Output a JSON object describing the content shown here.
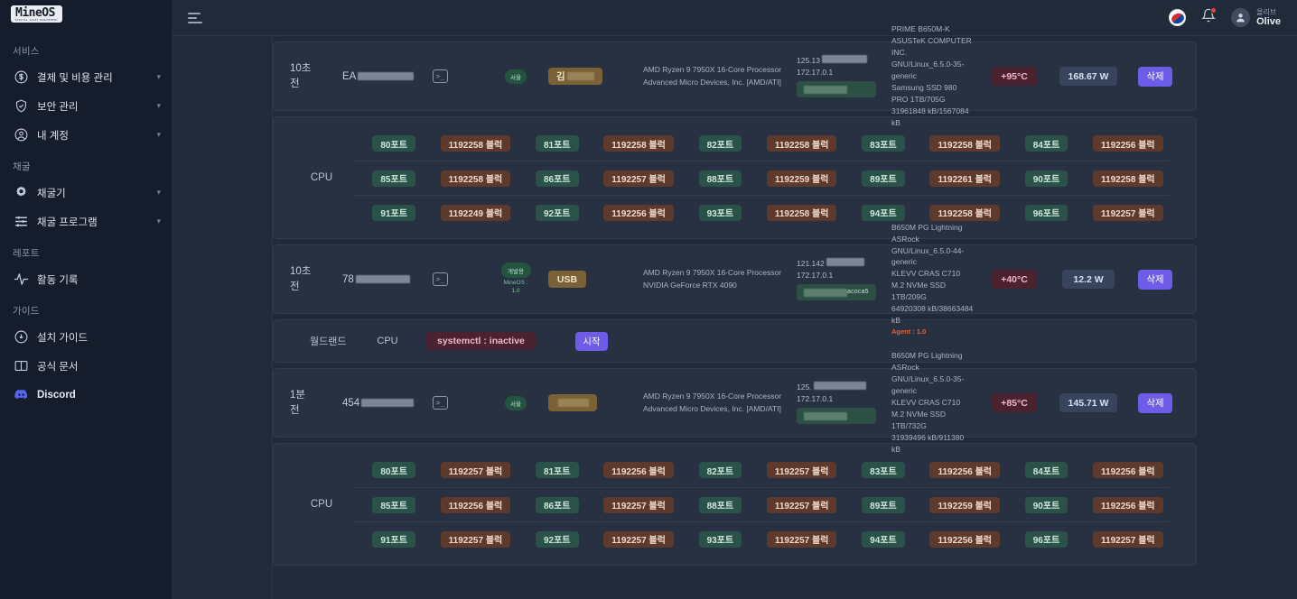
{
  "brand": {
    "logo": "MineOS",
    "logo_sub": "DIGITAL ASSET MANAGEMENT"
  },
  "sidebar": {
    "sections": [
      {
        "title": "서비스",
        "items": [
          {
            "label": "결제 및 비용 관리",
            "icon": "dollar-circle-icon",
            "caret": "⌄"
          },
          {
            "label": "보안 관리",
            "icon": "shield-check-icon",
            "caret": "⌄"
          },
          {
            "label": "내 계정",
            "icon": "user-circle-icon",
            "caret": "⌄"
          }
        ]
      },
      {
        "title": "채굴",
        "items": [
          {
            "label": "채굴기",
            "icon": "gear-icon",
            "caret": "⌄"
          },
          {
            "label": "채굴 프로그램",
            "icon": "sliders-icon",
            "caret": "⌄"
          }
        ]
      },
      {
        "title": "레포트",
        "items": [
          {
            "label": "활동 기록",
            "icon": "activity-pulse-icon",
            "caret": ""
          }
        ]
      },
      {
        "title": "가이드",
        "items": [
          {
            "label": "설치 가이드",
            "icon": "cloud-download-icon",
            "caret": ""
          },
          {
            "label": "공식 문서",
            "icon": "book-icon",
            "caret": ""
          },
          {
            "label": "Discord",
            "icon": "discord-icon",
            "caret": ""
          }
        ]
      }
    ]
  },
  "topbar": {
    "menu_icon": "hamburger-icon",
    "flag_icon": "korea-flag-icon",
    "bell_icon": "bell-icon",
    "notification_dot": true,
    "avatar_icon": "user-avatar-icon",
    "user_name_kr": "올리브",
    "user_name_en": "Olive"
  },
  "machines": [
    {
      "time": "10초 전",
      "name_prefix": "EA",
      "name_redact_width": 62,
      "terminal_icon": "terminal-icon",
      "region": "서울",
      "region_sub": "",
      "tag_prefix": "김",
      "tag_redact_width": 30,
      "tag_text": "",
      "cpu": "AMD Ryzen 9 7950X 16-Core Processor\nAdvanced Micro Devices, Inc. [AMD/ATI]",
      "ip1": "125.13",
      "ip1_redact_width": 50,
      "ip2": "172.17.0.1",
      "ip_badge": "",
      "ip_badge_redact": true,
      "spec": "PRIME B650M-K ASUSTeK COMPUTER INC.\nGNU/Linux_6.5.0-35-generic\nSamsung SSD 980 PRO 1TB/705G\n31961848 kB/1567084 kB",
      "agent": "",
      "temp": "+95°C",
      "watt": "168.67 W",
      "delete_label": "삭제"
    },
    {
      "time": "10초 전",
      "name_prefix": "78",
      "name_redact_width": 60,
      "terminal_icon": "terminal-icon",
      "region": "개발용",
      "region_sub": "MineOS :\n1.0",
      "tag_prefix": "",
      "tag_redact_width": 0,
      "tag_text": "USB",
      "cpu": "AMD Ryzen 9 7950X 16-Core Processor\nNVIDIA GeForce RTX 4090",
      "ip1": "121.142",
      "ip1_redact_width": 42,
      "ip2": "172.17.0.1",
      "ip_badge": "acoca5",
      "ip_badge_redact": true,
      "spec": "B650M PG Lightning ASRock\nGNU/Linux_6.5.0-44-generic\nKLEVV CRAS C710 M.2 NVMe SSD 1TB/209G\n64920308 kB/38663484 kB",
      "agent": "Agent : 1.0",
      "temp": "+40°C",
      "watt": "12.2 W",
      "delete_label": "삭제"
    },
    {
      "time": "1분 전",
      "name_prefix": "454",
      "name_redact_width": 58,
      "terminal_icon": "terminal-icon",
      "region": "서울",
      "region_sub": "",
      "tag_prefix": "",
      "tag_redact_width": 34,
      "tag_text": "",
      "cpu": "AMD Ryzen 9 7950X 16-Core Processor\nAdvanced Micro Devices, Inc. [AMD/ATI]",
      "ip1": "125.",
      "ip1_redact_width": 58,
      "ip2": "172.17.0.1",
      "ip_badge": "",
      "ip_badge_redact": true,
      "spec": "B650M PG Lightning ASRock\nGNU/Linux_6.5.0-35-generic\nKLEVV CRAS C710 M.2 NVMe SSD 1TB/732G\n31939496 kB/911380 kB",
      "agent": "",
      "temp": "+85°C",
      "watt": "145.71 W",
      "delete_label": "삭제"
    }
  ],
  "port_grids": [
    {
      "label": "CPU",
      "rows": [
        [
          "80포트",
          "1192258 블럭",
          "81포트",
          "1192258 블럭",
          "82포트",
          "1192258 블럭",
          "83포트",
          "1192258 블럭",
          "84포트",
          "1192256 블럭"
        ],
        [
          "85포트",
          "1192258 블럭",
          "86포트",
          "1192257 블럭",
          "88포트",
          "1192259 블럭",
          "89포트",
          "1192261 블럭",
          "90포트",
          "1192258 블럭"
        ],
        [
          "91포트",
          "1192249 블럭",
          "92포트",
          "1192256 블럭",
          "93포트",
          "1192258 블럭",
          "94포트",
          "1192258 블럭",
          "96포트",
          "1192257 블럭"
        ]
      ]
    },
    {
      "label": "CPU",
      "rows": [
        [
          "80포트",
          "1192257 블럭",
          "81포트",
          "1192256 블럭",
          "82포트",
          "1192257 블럭",
          "83포트",
          "1192256 블럭",
          "84포트",
          "1192256 블럭"
        ],
        [
          "85포트",
          "1192256 블럭",
          "86포트",
          "1192257 블럭",
          "88포트",
          "1192257 블럭",
          "89포트",
          "1192259 블럭",
          "90포트",
          "1192256 블럭"
        ],
        [
          "91포트",
          "1192257 블럭",
          "92포트",
          "1192257 블럭",
          "93포트",
          "1192257 블럭",
          "94포트",
          "1192256 블럭",
          "96포트",
          "1192257 블럭"
        ]
      ]
    }
  ],
  "service_row": {
    "name": "월드랜드",
    "type": "CPU",
    "status": "systemctl : inactive",
    "start_label": "시작"
  },
  "colors": {
    "accent_purple": "#6c5ce7",
    "temp_bg": "#4a2230",
    "watt_bg": "#37445c",
    "port_bg": "#2a5248",
    "block_bg": "#5e3a2c",
    "tag_bg": "#7a6236",
    "agent_text": "#e2622f"
  }
}
